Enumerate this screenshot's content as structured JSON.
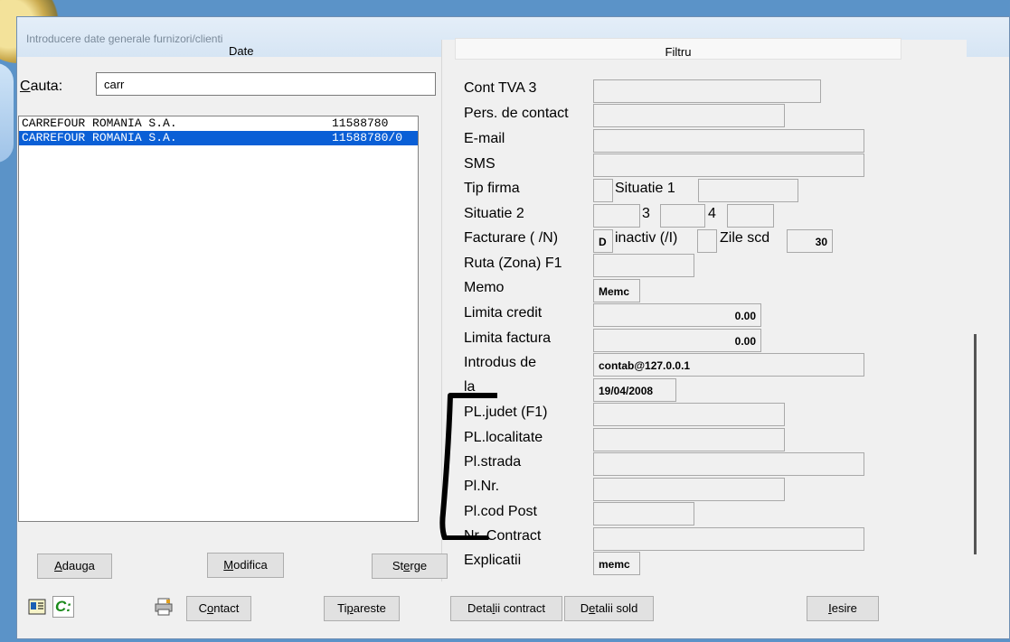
{
  "window": {
    "title": "Introducere date generale furnizori/clienti"
  },
  "tabs": {
    "date": "Date",
    "filtru": "Filtru"
  },
  "search": {
    "label_first": "C",
    "label_rest": "auta:",
    "value": "carr"
  },
  "list": [
    {
      "name": "CARREFOUR ROMANIA S.A.",
      "code": "11588780",
      "selected": false
    },
    {
      "name": "CARREFOUR ROMANIA S.A.",
      "code": "11588780/0",
      "selected": true
    }
  ],
  "buttons": {
    "adauga_u": "A",
    "adauga_rest": "dauga",
    "modifica_u": "M",
    "modifica_rest": "odifica",
    "sterge_pre": "St",
    "sterge_u": "e",
    "sterge_rest": "rge",
    "contact_pre": "C",
    "contact_u": "o",
    "contact_rest": "ntact",
    "tipareste_pre": "Ti",
    "tipareste_u": "p",
    "tipareste_rest": "areste",
    "detalii_contract_pre": "Deta",
    "detalii_contract_u": "l",
    "detalii_contract_rest": "ii contract",
    "detalii_sold_pre": "D",
    "detalii_sold_u": "e",
    "detalii_sold_rest": "talii sold",
    "iesire_u": "I",
    "iesire_rest": "esire"
  },
  "fields": {
    "cont_tva3": "Cont TVA 3",
    "pers_contact": "Pers. de contact",
    "email": "E-mail",
    "sms": "SMS",
    "tip_firma": "Tip firma",
    "situatie1": "Situatie 1",
    "situatie2": "Situatie 2",
    "sit3": "3",
    "sit4": "4",
    "facturare": "Facturare ( /N)",
    "facturare_val": "D",
    "inactiv": "inactiv (/I)",
    "zile_scd": "Zile scd",
    "zile_scd_val": "30",
    "ruta": "Ruta (Zona) F1",
    "memo": "Memo",
    "memo_val": "Memc",
    "limita_credit": "Limita credit",
    "limita_credit_val": "0.00",
    "limita_factura": "Limita factura",
    "limita_factura_val": "0.00",
    "introdus_de": "Introdus de",
    "introdus_de_val": "contab@127.0.0.1",
    "la": "la",
    "la_val": "19/04/2008",
    "pl_judet": "PL.judet (F1)",
    "pl_localitate": "PL.localitate",
    "pl_strada": "Pl.strada",
    "pl_nr": "Pl.Nr.",
    "pl_cod_post": "Pl.cod Post",
    "nr_contract": "Nr. Contract",
    "explicatii": "Explicatii",
    "explicatii_val": "memc"
  },
  "toolbar_icons": {
    "c_icon_text": "C:"
  },
  "colors": {
    "selection": "#0a5fd6",
    "bracket": "#000000"
  }
}
